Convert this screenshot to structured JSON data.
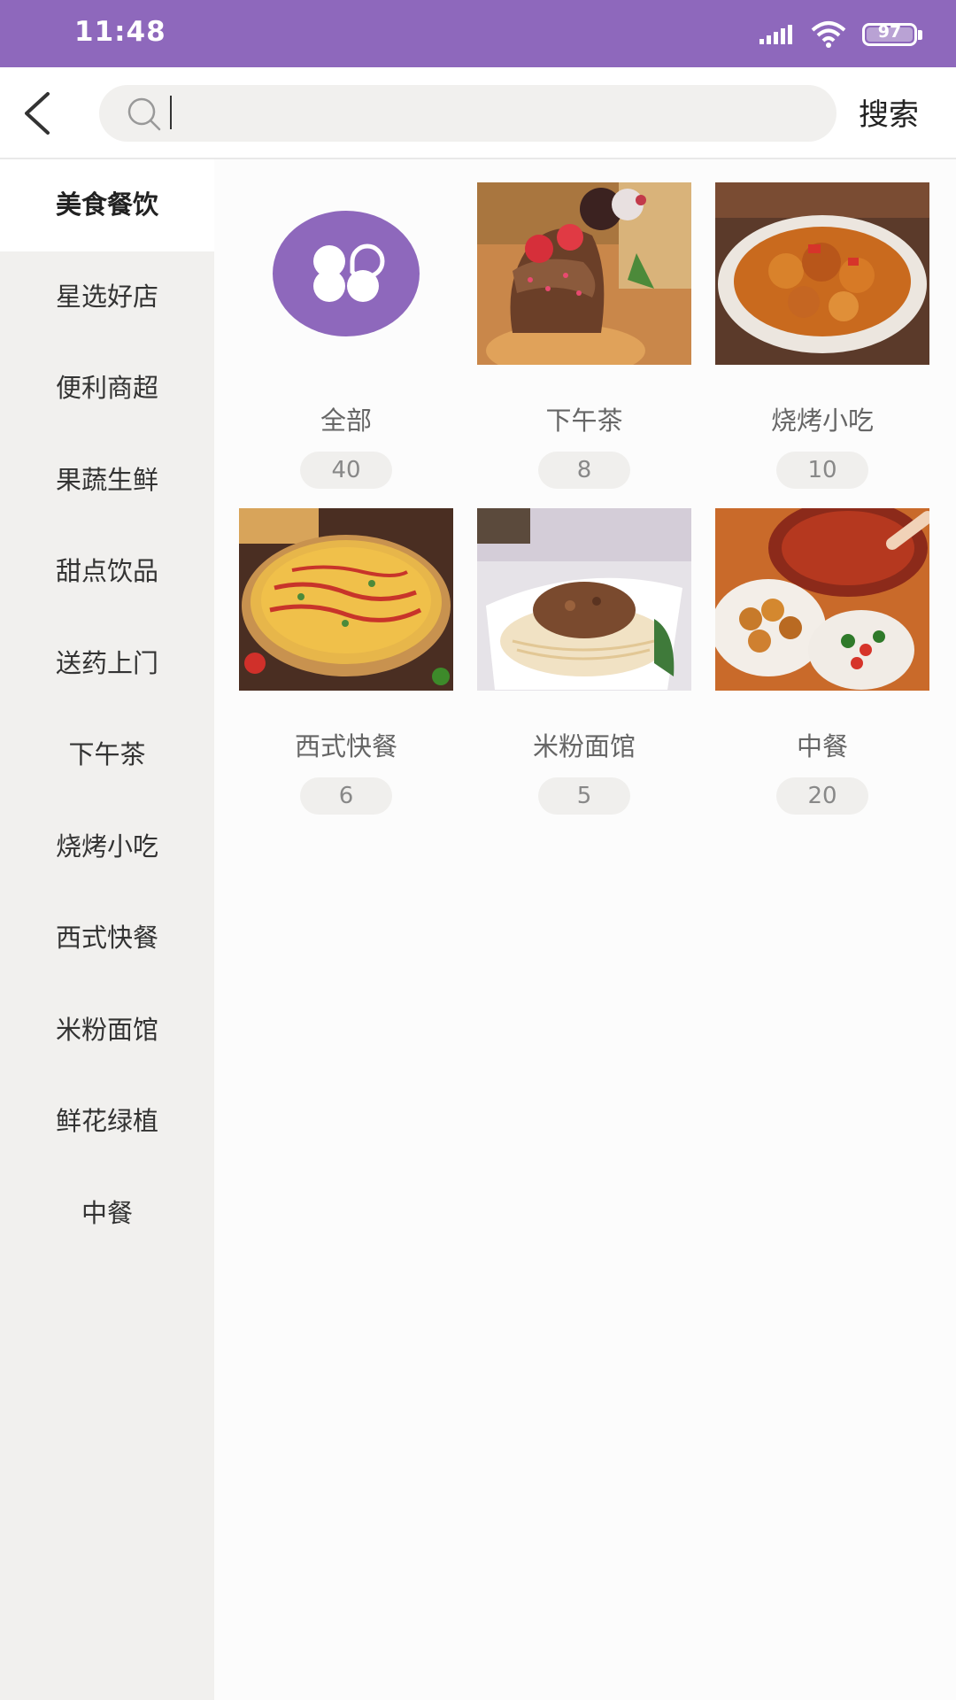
{
  "status_bar": {
    "time": "11:48",
    "battery": "97"
  },
  "search": {
    "placeholder": "",
    "button_label": "搜索"
  },
  "sidebar": {
    "items": [
      {
        "label": "美食餐饮",
        "active": true
      },
      {
        "label": "星选好店"
      },
      {
        "label": "便利商超"
      },
      {
        "label": "果蔬生鲜"
      },
      {
        "label": "甜点饮品"
      },
      {
        "label": "送药上门"
      },
      {
        "label": "下午茶"
      },
      {
        "label": "烧烤小吃"
      },
      {
        "label": "西式快餐"
      },
      {
        "label": "米粉面馆"
      },
      {
        "label": "鲜花绿植"
      },
      {
        "label": "中餐"
      }
    ]
  },
  "categories": [
    {
      "name": "全部",
      "count": "40",
      "icon": "all-categories-icon"
    },
    {
      "name": "下午茶",
      "count": "8",
      "image": "afternoon-tea-photo"
    },
    {
      "name": "烧烤小吃",
      "count": "10",
      "image": "bbq-snack-photo"
    },
    {
      "name": "西式快餐",
      "count": "6",
      "image": "pizza-photo"
    },
    {
      "name": "米粉面馆",
      "count": "5",
      "image": "noodle-photo"
    },
    {
      "name": "中餐",
      "count": "20",
      "image": "chinese-food-photo"
    }
  ],
  "colors": {
    "accent": "#8e68bc",
    "sidebar_bg": "#f1f0ee"
  }
}
